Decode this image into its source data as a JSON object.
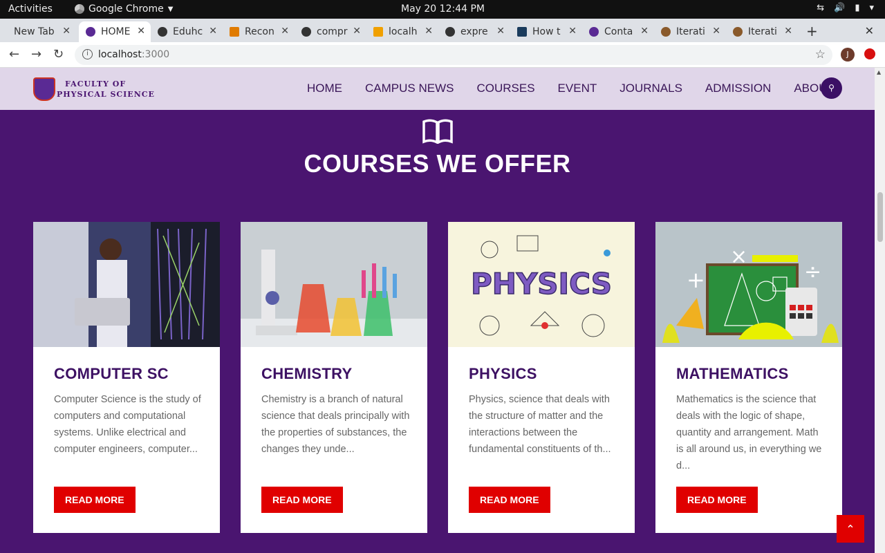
{
  "system_bar": {
    "activities": "Activities",
    "app_name": "Google Chrome",
    "clock": "May 20  12:44 PM"
  },
  "browser": {
    "tabs": [
      {
        "title": "New Tab",
        "active": false
      },
      {
        "title": "HOME",
        "active": true
      },
      {
        "title": "Eduhc",
        "active": false
      },
      {
        "title": "Recon",
        "active": false
      },
      {
        "title": "compr",
        "active": false
      },
      {
        "title": "localh",
        "active": false
      },
      {
        "title": "expre",
        "active": false
      },
      {
        "title": "How t",
        "active": false
      },
      {
        "title": "Conta",
        "active": false
      },
      {
        "title": "Iterati",
        "active": false
      },
      {
        "title": "Iterati",
        "active": false
      }
    ],
    "url_host": "localhost",
    "url_port": ":3000",
    "profile_initial": "J"
  },
  "site": {
    "logo_line1": "FACULTY OF",
    "logo_line2": "PHYSICAL SCIENCE",
    "nav": [
      "HOME",
      "CAMPUS NEWS",
      "COURSES",
      "EVENT",
      "JOURNALS",
      "ADMISSION",
      "ABOUT"
    ],
    "section_title": "COURSES WE OFFER",
    "courses": [
      {
        "title": "COMPUTER SC",
        "description": "Computer Science is the study of computers and computational systems. Unlike electrical and computer engineers, computer...",
        "button": "READ MORE"
      },
      {
        "title": "CHEMISTRY",
        "description": "Chemistry is a branch of natural science that deals principally with the properties of substances, the changes they unde...",
        "button": "READ MORE"
      },
      {
        "title": "PHYSICS",
        "description": "Physics, science that deals with the structure of matter and the interactions between the fundamental constituents of th...",
        "button": "READ MORE"
      },
      {
        "title": "MATHEMATICS",
        "description": "Mathematics is the science that deals with the logic of shape, quantity and arrangement. Math is all around us, in everything we d...",
        "button": "READ MORE"
      }
    ],
    "image_text": {
      "physics": "PHYSICS"
    }
  },
  "colors": {
    "page_bg": "#4a1570",
    "header_bg": "#e0d6e9",
    "accent_red": "#e00000",
    "title_purple": "#3d1163"
  }
}
